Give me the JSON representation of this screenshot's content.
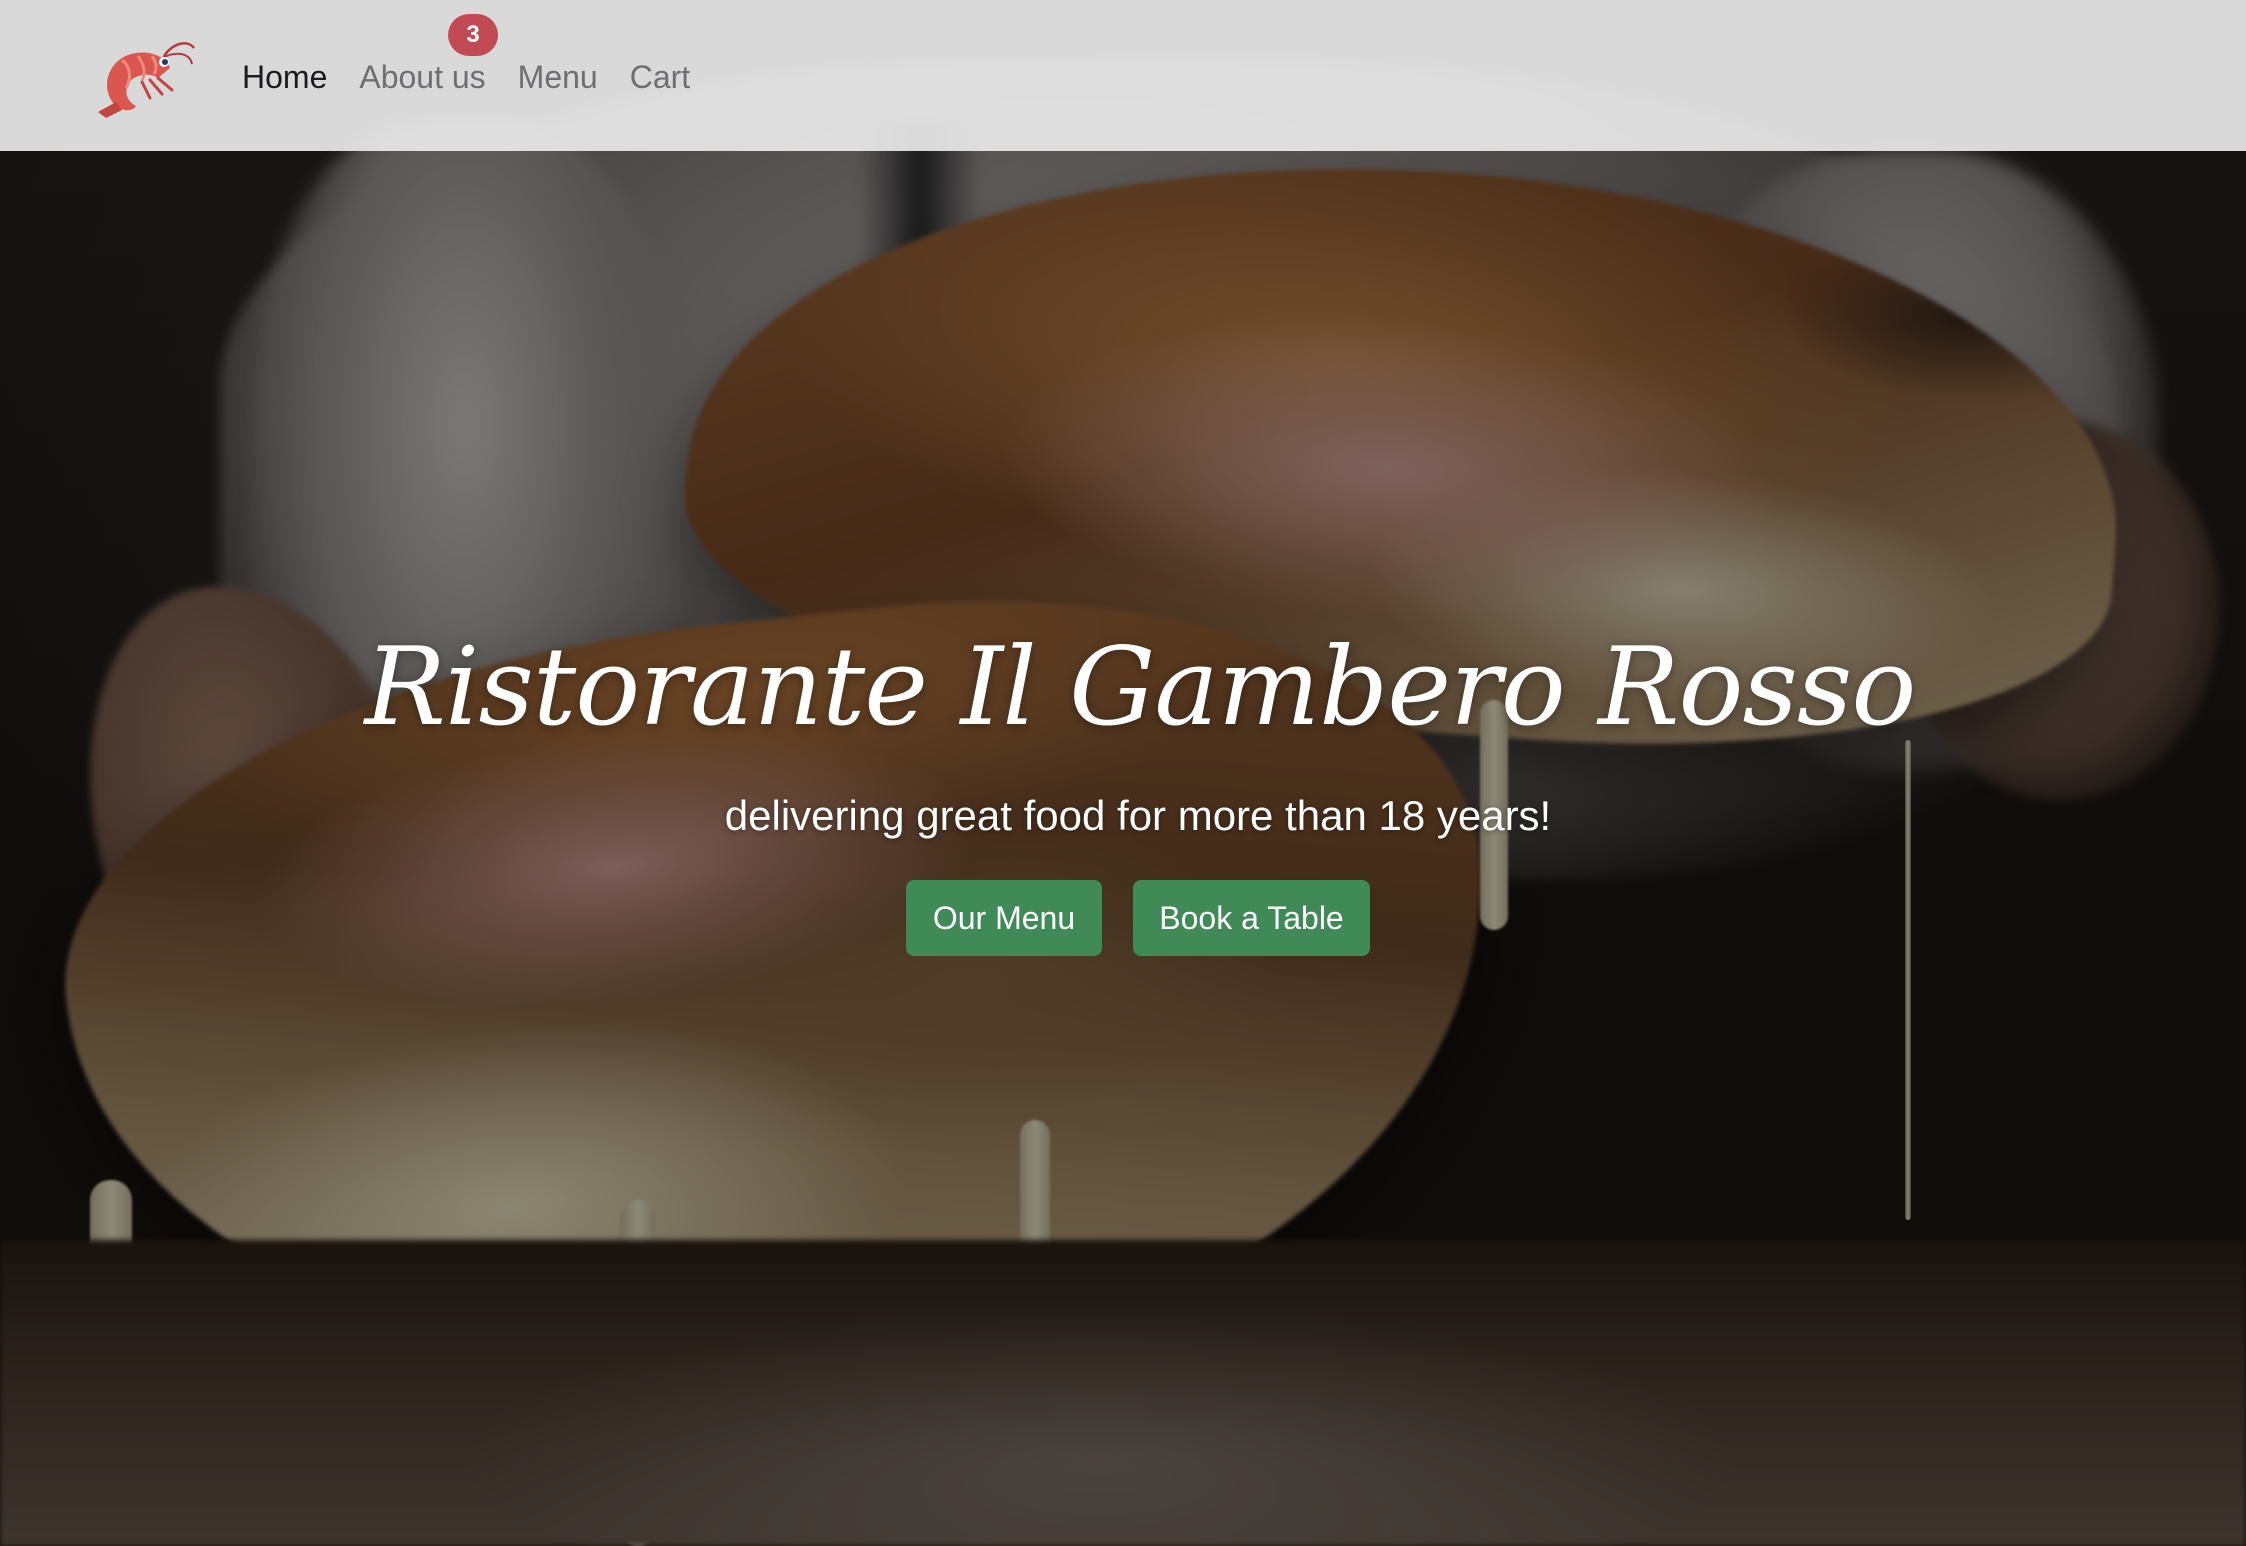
{
  "navbar": {
    "logo": "shrimp-logo",
    "links": [
      {
        "label": "Home",
        "active": true
      },
      {
        "label": "About us",
        "active": false
      },
      {
        "label": "Menu",
        "active": false
      },
      {
        "label": "Cart",
        "active": false
      }
    ],
    "cart_count": "3",
    "badge_color": "#c24a55"
  },
  "hero": {
    "title": "Ristorante Il Gambero Rosso",
    "subtitle": "delivering great food for more than 18 years!",
    "buttons": {
      "menu_label": "Our Menu",
      "book_label": "Book a Table"
    },
    "button_color": "#3f8a57",
    "background": "calzone-photo"
  }
}
